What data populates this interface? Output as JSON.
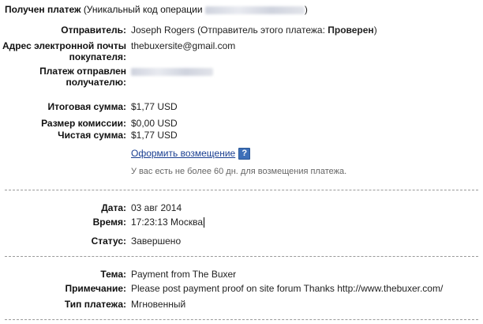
{
  "header": {
    "title": "Получен платеж",
    "code_prefix": "(Уникальный код операции",
    "code_suffix": ")"
  },
  "sender": {
    "label": "Отправитель:",
    "name": "Joseph Rogers",
    "status_prefix": "(Отправитель этого платежа:",
    "status": "Проверен",
    "status_suffix": ")"
  },
  "buyer_email": {
    "label_line1": "Адрес электронной почты",
    "label_line2": "покупателя:",
    "value": "thebuxersite@gmail.com"
  },
  "sent_to": {
    "label_line1": "Платеж отправлен",
    "label_line2": "получателю:"
  },
  "amounts": {
    "total_label": "Итоговая сумма:",
    "total": "$1,77 USD",
    "fee_label": "Размер комиссии:",
    "fee": "$0,00 USD",
    "net_label": "Чистая сумма:",
    "net": "$1,77 USD"
  },
  "refund": {
    "link": "Оформить возмещение",
    "help_icon": "?",
    "note": "У вас есть не более 60 дн. для возмещения платежа."
  },
  "details": {
    "date_label": "Дата:",
    "date": "03 авг 2014",
    "time_label": "Время:",
    "time": "17:23:13 Москва",
    "status_label": "Статус:",
    "status": "Завершено"
  },
  "message": {
    "subject_label": "Тема:",
    "subject": "Payment from The Buxer",
    "memo_label": "Примечание:",
    "memo": "Please post payment proof on site forum Thanks http://www.thebuxer.com/",
    "type_label": "Тип платежа:",
    "type": "Мгновенный"
  }
}
